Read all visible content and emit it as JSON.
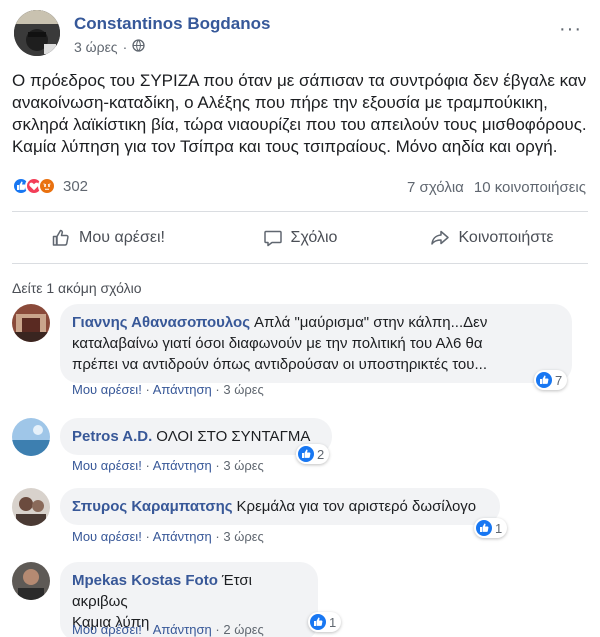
{
  "post": {
    "author": "Constantinos Bogdanos",
    "time": "3 ώρες",
    "separator": "·",
    "privacy_icon": "globe-icon",
    "more_label": "···",
    "text_lines": [
      "Ο πρόεδρος του ΣΥΡΙΖΑ που όταν με σάπισαν τα συντρόφια δεν έβγαλε καν",
      "ανακοίνωση-καταδίκη, ο Αλέξης που πήρε την εξουσία με τραμπούκικη,",
      "σκληρά λαϊκίστικη βία, τώρα νιαουρίζει που του απειλούν τους μισθοφόρους.",
      "Καμία λύπηση για τον Τσίπρα και τους τσιπραίους. Μόνο αηδία και οργή."
    ],
    "reaction_icons": [
      "like-reaction-icon",
      "love-reaction-icon",
      "angry-reaction-icon"
    ],
    "reaction_count": "302",
    "comments_count": "7 σχόλια",
    "shares_count": "10 κοινοποιήσεις"
  },
  "actions": {
    "like": "Μου αρέσει!",
    "comment": "Σχόλιο",
    "share": "Κοινοποιήστε"
  },
  "more_comments": "Δείτε 1 ακόμη σχόλιο",
  "comments": [
    {
      "name": "Γιαννης Αθανασοπουλος",
      "line1": "Απλά \"μαύρισμα\" στην κάλπη...Δεν",
      "line2": "καταλαβαίνω γιατί όσοι διαφωνούν με την πολιτική του Αλ6 θα",
      "line3": "πρέπει να αντιδρούν όπως αντιδρούσαν οι υποστηρικτές του...",
      "like": "Μου αρέσει!",
      "reply": "Απάντηση",
      "time": "3 ώρες",
      "reactions": "7"
    },
    {
      "name": "Petros A.D.",
      "line1": "ΟΛΟΙ ΣΤΟ ΣΥΝΤΑΓΜΑ",
      "like": "Μου αρέσει!",
      "reply": "Απάντηση",
      "time": "3 ώρες",
      "reactions": "2"
    },
    {
      "name": "Σπυρος Καραμπατσης",
      "line1": "Κρεμάλα για τον αριστερό δωσίλογο",
      "like": "Μου αρέσει!",
      "reply": "Απάντηση",
      "time": "3 ώρες",
      "reactions": "1"
    },
    {
      "name": "Mpekas Kostas Foto",
      "line1": "Έτσι ακριβως",
      "line2": "Καμια λύπη",
      "like": "Μου αρέσει!",
      "reply": "Απάντηση",
      "time": "2 ώρες",
      "reactions": "1"
    }
  ],
  "sep": "·",
  "colors": {
    "name_link": "#365899",
    "like_blue": "#1877f2",
    "love_red": "#f33e58",
    "angry_orange": "#e9710f",
    "bubble_bg": "#f2f3f5",
    "meta_gray": "#606770"
  }
}
